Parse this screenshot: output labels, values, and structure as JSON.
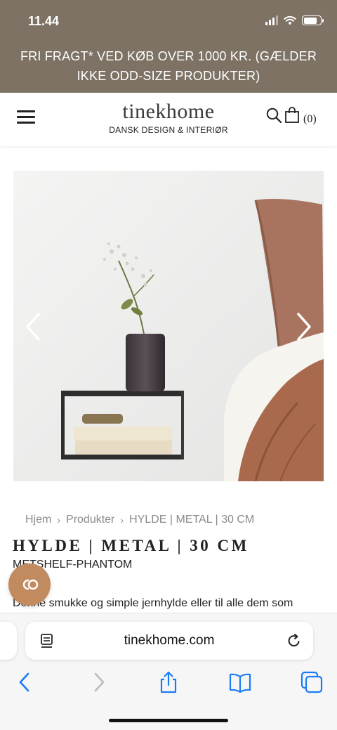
{
  "status_bar": {
    "time": "11.44"
  },
  "promo": {
    "text": "FRI FRAGT* VED KØB OVER 1000 KR. (GÆLDER IKKE ODD-SIZE PRODUKTER)"
  },
  "header": {
    "logo_text": "tinekhome",
    "logo_tagline": "DANSK DESIGN & INTERIØR",
    "cart_count": "(0)"
  },
  "breadcrumb": {
    "items": [
      "Hjem",
      "Produkter",
      "HYLDE | METAL | 30 CM"
    ]
  },
  "product": {
    "title": "HYLDE | METAL | 30 CM",
    "sku": "METSHELF-PHANTOM",
    "description": "Denne smukke og simple jernhylde eller til alle dem som"
  },
  "browser": {
    "url": "tinekhome.com"
  },
  "colors": {
    "banner_bg": "#7d7264",
    "chat_bg": "#c28a5f",
    "safari_blue": "#1a7cf5"
  },
  "icons": {
    "menu": "hamburger-icon",
    "search": "search-icon",
    "cart": "shopping-bag-icon",
    "prev": "chevron-left-icon",
    "next": "chevron-right-icon",
    "chat": "chat-icon",
    "reader": "reader-mode-icon",
    "reload": "reload-icon",
    "back": "back-arrow-icon",
    "forward": "forward-arrow-icon",
    "share": "share-icon",
    "bookmarks": "bookmarks-icon",
    "tabs": "tabs-icon"
  }
}
